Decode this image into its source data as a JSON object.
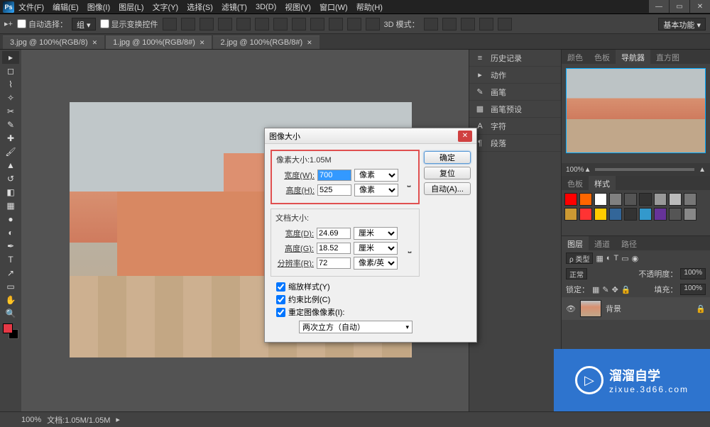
{
  "app": {
    "logo": "Ps"
  },
  "menu": [
    "文件(F)",
    "编辑(E)",
    "图像(I)",
    "图层(L)",
    "文字(Y)",
    "选择(S)",
    "滤镜(T)",
    "3D(D)",
    "视图(V)",
    "窗口(W)",
    "帮助(H)"
  ],
  "opts": {
    "auto_select": "自动选择：",
    "group": "组",
    "show_transform": "显示变换控件",
    "mode3d": "3D 模式：",
    "workspace": "基本功能"
  },
  "tabs": [
    {
      "label": "3.jpg @ 100%(RGB/8)",
      "active": false
    },
    {
      "label": "1.jpg @ 100%(RGB/8#)",
      "active": true
    },
    {
      "label": "2.jpg @ 100%(RGB/8#)",
      "active": false
    }
  ],
  "right_strip": [
    {
      "icon": "≡",
      "label": "历史记录"
    },
    {
      "icon": "▸",
      "label": "动作"
    },
    {
      "icon": "✎",
      "label": "画笔"
    },
    {
      "icon": "▦",
      "label": "画笔预设"
    },
    {
      "icon": "A",
      "label": "字符"
    },
    {
      "icon": "¶",
      "label": "段落"
    }
  ],
  "panel_tabs_top": [
    "颜色",
    "色板",
    "导航器",
    "直方图"
  ],
  "nav": {
    "zoom": "100%"
  },
  "swatch_tabs": [
    "色板",
    "样式"
  ],
  "swatch_colors": [
    [
      "#ff0000",
      "#ff6600",
      "#ffffff",
      "#808080",
      "#555555",
      "#333333",
      "#999999",
      "#bbbbbb",
      "#777777"
    ],
    [
      "#cc9933",
      "#ff3333",
      "#ffcc00",
      "#336699",
      "#333333",
      "#3399cc",
      "#663399",
      "#555555",
      "#888888"
    ]
  ],
  "layers": {
    "tabs": [
      "图层",
      "通道",
      "路径"
    ],
    "kind": "ρ 类型",
    "mode": "正常",
    "opacity_lbl": "不透明度：",
    "opacity": "100%",
    "lock_lbl": "锁定：",
    "fill_lbl": "填充：",
    "fill": "100%",
    "item_name": "背景",
    "item_lock": "🔒"
  },
  "status": {
    "zoom": "100%",
    "info": "文档:1.05M/1.05M"
  },
  "dialog": {
    "title": "图像大小",
    "px_legend": "像素大小:1.05M",
    "width_lbl": "宽度(W):",
    "width": "700",
    "width_unit": "像素",
    "height_lbl": "高度(H):",
    "height": "525",
    "height_unit": "像素",
    "doc_legend": "文档大小:",
    "dwidth_lbl": "宽度(D):",
    "dwidth": "24.69",
    "dwidth_unit": "厘米",
    "dheight_lbl": "高度(G):",
    "dheight": "18.52",
    "dheight_unit": "厘米",
    "res_lbl": "分辨率(R):",
    "res": "72",
    "res_unit": "像素/英寸",
    "scale_styles": "缩放样式(Y)",
    "constrain": "约束比例(C)",
    "resample": "重定图像像素(I):",
    "resample_method": "两次立方（自动）",
    "ok": "确定",
    "reset": "复位",
    "auto": "自动(A)..."
  },
  "watermark": {
    "t1": "溜溜自学",
    "t2": "zixue.3d66.com"
  }
}
